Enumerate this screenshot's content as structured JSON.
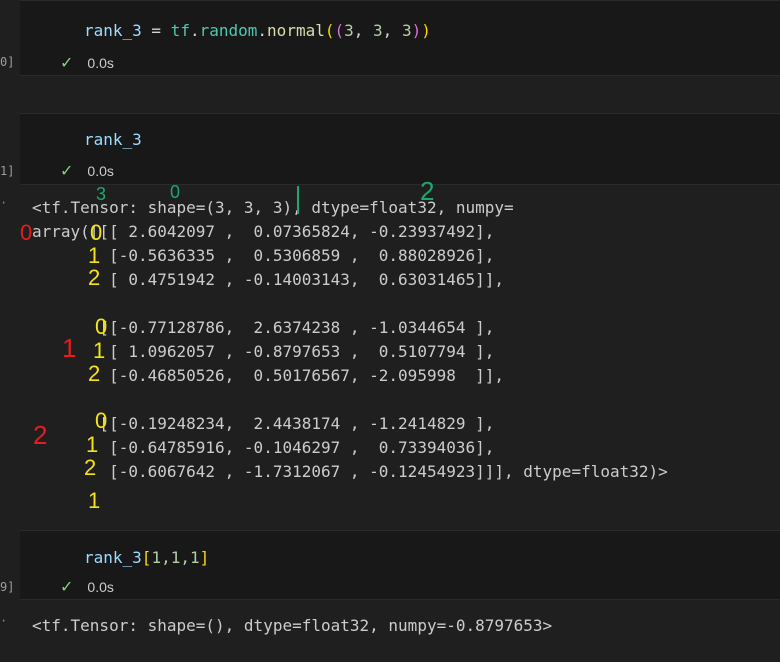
{
  "cells": [
    {
      "exec_label": "0]",
      "code": {
        "var": "rank_3",
        "eq": " = ",
        "mod": "tf",
        "dot1": ".",
        "attr1": "random",
        "dot2": ".",
        "fn": "normal",
        "open1": "(",
        "open2": "(",
        "a": "3",
        "c1": ", ",
        "b": "3",
        "c2": ", ",
        "c": "3",
        "close2": ")",
        "close1": ")"
      },
      "status_time": "0.0s"
    },
    {
      "exec_label": "1]",
      "code_text": "rank_3",
      "status_time": "0.0s"
    },
    {
      "exec_label": "9]",
      "code": {
        "var": "rank_3",
        "open": "[",
        "args": "1,1,1",
        "close": "]"
      },
      "status_time": "0.0s"
    }
  ],
  "output1": {
    "bullet": "·",
    "lines": [
      "<tf.Tensor: shape=(3, 3, 3), dtype=float32, numpy=",
      "array([[[ 2.6042097 ,  0.07365824, -0.23937492],",
      "        [-0.5636335 ,  0.5306859 ,  0.88028926],",
      "        [ 0.4751942 , -0.14003143,  0.63031465]],",
      "",
      "       [[-0.77128786,  2.6374238 , -1.0344654 ],",
      "        [ 1.0962057 , -0.8797653 ,  0.5107794 ],",
      "        [-0.46850526,  0.50176567, -2.095998  ]],",
      "",
      "       [[-0.19248234,  2.4438174 , -1.2414829 ],",
      "        [-0.64785916, -0.1046297 ,  0.73394036],",
      "        [-0.6067642 , -1.7312067 , -0.12454923]]], dtype=float32)>"
    ]
  },
  "output2": {
    "bullet": "·",
    "text": "<tf.Tensor: shape=(), dtype=float32, numpy=-0.8797653>"
  },
  "annotations": {
    "g3": "3",
    "g0": "0",
    "g2": "2",
    "r0": "0",
    "r1": "1",
    "r2": "2",
    "b1_0": "0",
    "b1_1": "1",
    "b1_2": "2",
    "b2_0": "0",
    "b2_1": "1",
    "b2_2": "2",
    "b3_0": "0",
    "b3_1": "1",
    "b3_2": "2",
    "extra1": "1"
  }
}
